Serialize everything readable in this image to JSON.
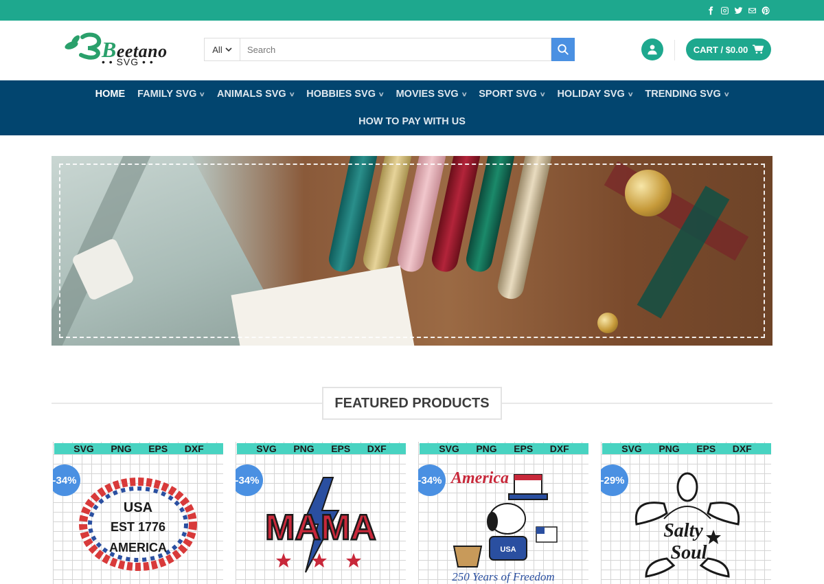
{
  "topbar": {
    "social_icons": [
      "facebook-icon",
      "instagram-icon",
      "twitter-icon",
      "email-icon",
      "pinterest-icon"
    ]
  },
  "header": {
    "logo_text": "eetano",
    "logo_letter": "B",
    "logo_sub": "SVG",
    "search": {
      "category": "All",
      "placeholder": "Search"
    },
    "cart_label": "CART / $0.00"
  },
  "nav": {
    "items": [
      {
        "label": "HOME",
        "active": true
      },
      {
        "label": "FAMILY SVG"
      },
      {
        "label": "ANIMALS SVG"
      },
      {
        "label": "HOBBIES SVG"
      },
      {
        "label": "MOVIES SVG"
      },
      {
        "label": "SPORT SVG"
      },
      {
        "label": "HOLIDAY SVG"
      },
      {
        "label": "TRENDING SVG"
      }
    ],
    "second_row": "HOW TO PAY WITH US"
  },
  "featured": {
    "title": "FEATURED PRODUCTS"
  },
  "products": [
    {
      "formats": [
        "SVG",
        "PNG",
        "EPS",
        "DXF"
      ],
      "discount": "-34%",
      "art_text": [
        "USA",
        "EST 1776",
        "AMERICA"
      ]
    },
    {
      "formats": [
        "SVG",
        "PNG",
        "EPS",
        "DXF"
      ],
      "discount": "-34%",
      "art_text": [
        "MAMA"
      ]
    },
    {
      "formats": [
        "SVG",
        "PNG",
        "EPS",
        "DXF"
      ],
      "discount": "-34%",
      "art_text": [
        "America",
        "USA",
        "250 Years of Freedom"
      ]
    },
    {
      "formats": [
        "SVG",
        "PNG",
        "EPS",
        "DXF"
      ],
      "discount": "-29%",
      "art_text": [
        "Salty",
        "Soul"
      ]
    }
  ],
  "colors": {
    "topbar": "#1ea88e",
    "nav": "#02456f",
    "accent": "#1ea88e",
    "badge": "#4a90e2",
    "format_strip": "#48d3c1"
  }
}
